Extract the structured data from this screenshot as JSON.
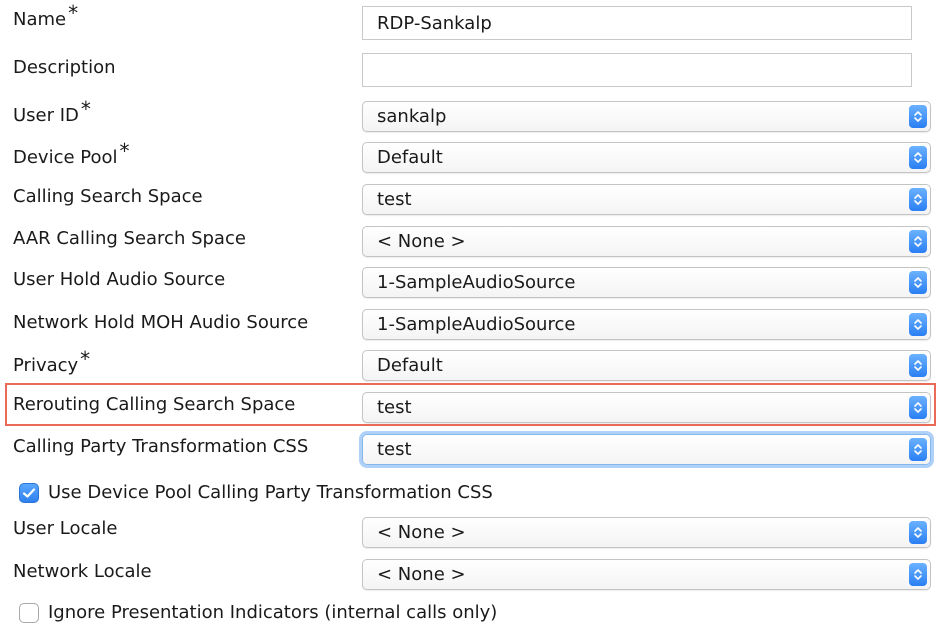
{
  "required_marker": "*",
  "fields": {
    "name": {
      "label": "Name",
      "value": "RDP-Sankalp"
    },
    "description": {
      "label": "Description",
      "value": ""
    },
    "user_id": {
      "label": "User ID",
      "value": "sankalp"
    },
    "device_pool": {
      "label": "Device Pool",
      "value": "Default"
    },
    "calling_search_space": {
      "label": "Calling Search Space",
      "value": "test"
    },
    "aar_calling_search_space": {
      "label": "AAR Calling Search Space",
      "value": "< None >"
    },
    "user_hold_audio_source": {
      "label": "User Hold Audio Source",
      "value": "1-SampleAudioSource"
    },
    "network_hold_moh_audio_source": {
      "label": "Network Hold MOH Audio Source",
      "value": "1-SampleAudioSource"
    },
    "privacy": {
      "label": "Privacy",
      "value": "Default"
    },
    "rerouting_calling_search_space": {
      "label": "Rerouting Calling Search Space",
      "value": "test"
    },
    "calling_party_transformation_css": {
      "label": "Calling Party Transformation CSS",
      "value": "test"
    },
    "use_device_pool_cpt_css": {
      "label": "Use Device Pool Calling Party Transformation CSS",
      "checked": true
    },
    "user_locale": {
      "label": "User Locale",
      "value": "< None >"
    },
    "network_locale": {
      "label": "Network Locale",
      "value": "< None >"
    },
    "ignore_presentation_indicators": {
      "label": "Ignore Presentation Indicators (internal calls only)",
      "checked": false
    }
  },
  "icons": {
    "select_arrow": "chevron-up-down-icon",
    "checkmark": "checkmark-icon"
  },
  "colors": {
    "highlight_border": "#e86a57",
    "select_arrow": "#2f80ef",
    "focus_ring": "#6eaaf0"
  }
}
